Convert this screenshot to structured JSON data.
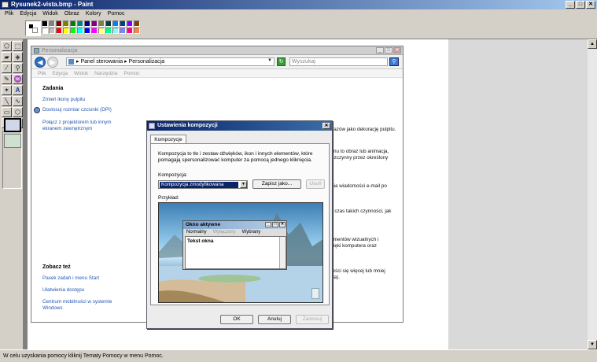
{
  "paint": {
    "title": "Rysunek2-vista.bmp - Paint",
    "menu": [
      "Plik",
      "Edycja",
      "Widok",
      "Obraz",
      "Kolory",
      "Pomoc"
    ],
    "status": "W celu uzyskania pomocy kliknij Tematy Pomocy w menu Pomoc.",
    "palette": [
      "#000000",
      "#808080",
      "#800000",
      "#808000",
      "#008000",
      "#008080",
      "#000080",
      "#800080",
      "#808040",
      "#004040",
      "#0080ff",
      "#004080",
      "#8000ff",
      "#804000",
      "#ffffff",
      "#c0c0c0",
      "#ff0000",
      "#ffff00",
      "#00ff00",
      "#00ffff",
      "#0000ff",
      "#ff00ff",
      "#ffff80",
      "#00ff80",
      "#80ffff",
      "#8080ff",
      "#ff0080",
      "#ff8040"
    ]
  },
  "personalization": {
    "title": "Personalizacja",
    "address": "▸ Panel sterowania ▸ Personalizacja",
    "search_placeholder": "Wyszukaj",
    "menu": [
      "Plik",
      "Edycja",
      "Widok",
      "Narzędzia",
      "Pomoc"
    ],
    "tasks_heading": "Zadania",
    "tasks": [
      "Zmień ikony pulpitu",
      "Dostosuj rozmiar czcionki (DPI)",
      "Połącz z projektorem lub innym ekranem zewnętrznym"
    ],
    "see_also_heading": "Zobacz też",
    "see_also": [
      "Pasek zadań i menu Start",
      "Ułatwienia dostępu",
      "Centrum mobilności w systemie Windows"
    ],
    "right_snippets": [
      "chych obrazów jako dekorację pulpitu.",
      "zacz ekranu to obraz lub animacja,",
      "ter jest bezczynny przez określony",
      "j odbierania wiadomości e-mail po",
      "myszy na czas takich czynności, jak",
      "k",
      "żnych elementów wizualnych i",
      "które dźwięki komputera oraz",
      "kranie mieści się więcej lub mniej",
      "dświeżania)."
    ]
  },
  "dialog": {
    "title": "Ustawienia kompozycji",
    "tab": "Kompozycje",
    "description": "Kompozycja to tło i zestaw dźwięków, ikon i innych elementów, które pomagają spersonalizować komputer za pomocą jednego kliknięcia.",
    "theme_label": "Kompozycja:",
    "theme_value": "Kompozycja zmodyfikowana",
    "save_as": "Zapisz jako...",
    "delete": "Usuń",
    "preview_label": "Przykład:",
    "active_window_title": "Okno aktywne",
    "active_window_menu": [
      "Normalny",
      "Wyłączony",
      "Wybrany"
    ],
    "window_text": "Tekst okna",
    "ok": "OK",
    "cancel": "Anuluj",
    "apply": "Zastosuj"
  }
}
